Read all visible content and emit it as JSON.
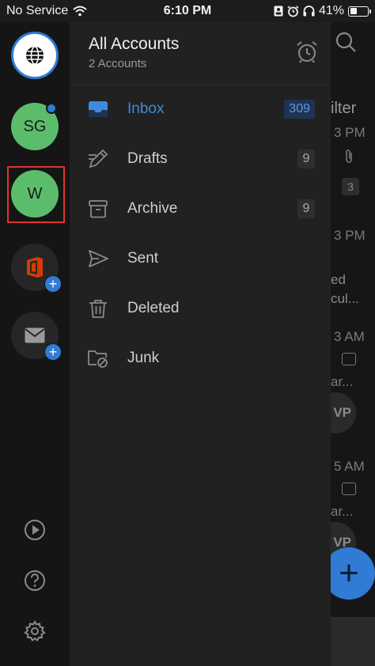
{
  "status_bar": {
    "carrier": "No Service",
    "time": "6:10 PM",
    "battery_percent": "41%",
    "battery_level": 0.41
  },
  "accounts_rail": {
    "accounts": [
      {
        "initials": "SG",
        "color": "#5bbd6b",
        "has_unread_dot": true
      },
      {
        "initials": "W",
        "color": "#5bbd6b",
        "selected": true
      }
    ],
    "add_badge": "+"
  },
  "panel": {
    "title": "All Accounts",
    "subtitle": "2 Accounts"
  },
  "folders": [
    {
      "label": "Inbox",
      "count": "309",
      "icon": "inbox-icon",
      "active": true
    },
    {
      "label": "Drafts",
      "count": "9",
      "icon": "pen-icon"
    },
    {
      "label": "Archive",
      "count": "9",
      "icon": "archive-icon"
    },
    {
      "label": "Sent",
      "count": "",
      "icon": "send-icon"
    },
    {
      "label": "Deleted",
      "count": "",
      "icon": "trash-icon"
    },
    {
      "label": "Junk",
      "count": "",
      "icon": "junk-folder-icon"
    }
  ],
  "underlay": {
    "filter_partial": "ilter",
    "time_1": "3 PM",
    "badge_1": "3",
    "time_2": "3 PM",
    "text_1": "ed",
    "text_2": "cul...",
    "time_3": "3 AM",
    "text_3": "ar...",
    "avatar_partial": "VP",
    "time_4": "5 AM",
    "text_4": "ar...",
    "avatar_partial_2": "VP",
    "fab": "+"
  },
  "colors": {
    "accent": "#2f7bd6",
    "active_text": "#3f8ae0",
    "highlight_box": "#e0322e"
  }
}
